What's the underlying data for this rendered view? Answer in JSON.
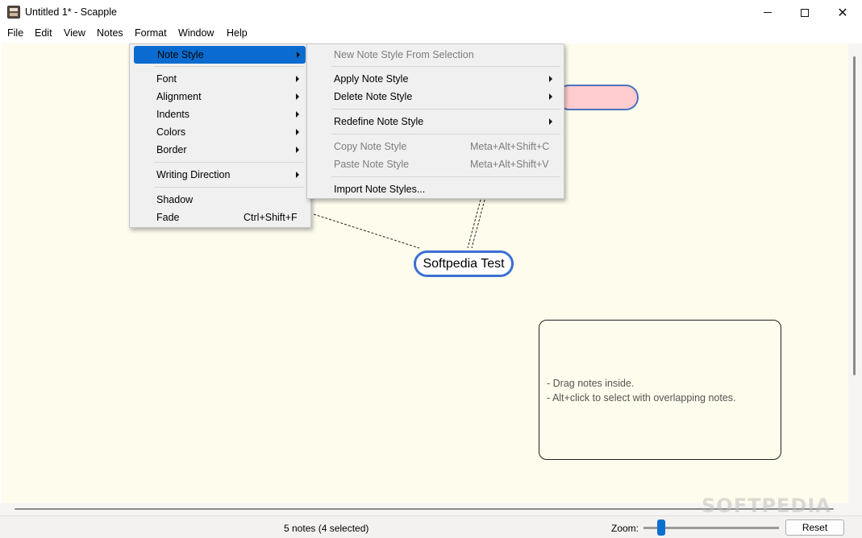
{
  "window": {
    "title": "Untitled 1* - Scapple"
  },
  "menubar": {
    "items": [
      "File",
      "Edit",
      "View",
      "Notes",
      "Format",
      "Window",
      "Help"
    ]
  },
  "format_menu": {
    "items": [
      {
        "label": "Note Style",
        "submenu": true,
        "highlighted": true
      },
      {
        "label": "Font",
        "submenu": true
      },
      {
        "label": "Alignment",
        "submenu": true
      },
      {
        "label": "Indents",
        "submenu": true
      },
      {
        "label": "Colors",
        "submenu": true
      },
      {
        "label": "Border",
        "submenu": true
      },
      {
        "label": "Writing Direction",
        "submenu": true
      },
      {
        "label": "Shadow"
      },
      {
        "label": "Fade",
        "shortcut": "Ctrl+Shift+F"
      }
    ]
  },
  "note_style_menu": {
    "items": [
      {
        "label": "New Note Style From Selection",
        "disabled": true
      },
      {
        "label": "Apply Note Style",
        "submenu": true
      },
      {
        "label": "Delete Note Style",
        "submenu": true
      },
      {
        "label": "Redefine Note Style",
        "submenu": true
      },
      {
        "label": "Copy Note Style",
        "shortcut": "Meta+Alt+Shift+C",
        "disabled": true
      },
      {
        "label": "Paste Note Style",
        "shortcut": "Meta+Alt+Shift+V",
        "disabled": true
      },
      {
        "label": "Import Note Styles..."
      }
    ]
  },
  "canvas": {
    "notes": {
      "softpedia": "Softpedia Test",
      "pink": ""
    },
    "drop_box": {
      "line1": "- Drag notes inside.",
      "line2": "- Alt+click to select with overlapping notes."
    }
  },
  "statusbar": {
    "status": "5 notes (4 selected)",
    "zoom_label": "Zoom:",
    "reset_label": "Reset"
  },
  "watermark": "SOFTPEDIA",
  "colors": {
    "canvas_bg": "#fefcec",
    "highlight": "#0a6cd0",
    "note_border": "#3b6fd4",
    "pink_note": "#ffcdcf"
  }
}
